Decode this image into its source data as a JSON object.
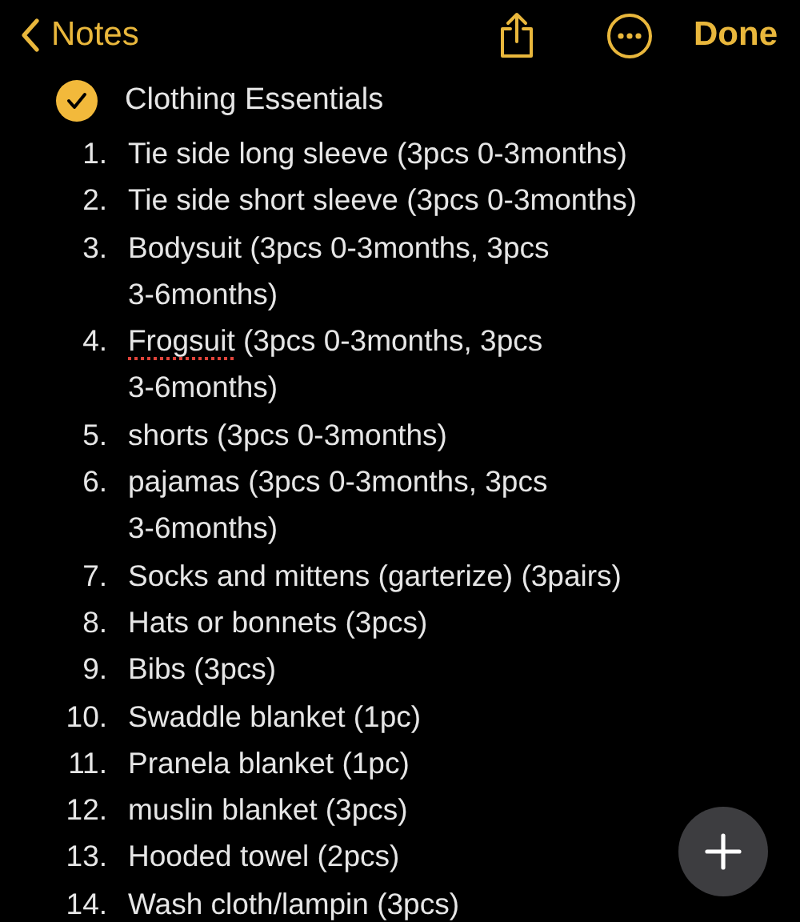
{
  "nav": {
    "back_label": "Notes",
    "done_label": "Done"
  },
  "checklist_title": {
    "text": "Clothing Essentials",
    "checked": true
  },
  "items": [
    {
      "number": "1.",
      "lines": [
        "Tie side long sleeve (3pcs 0-3months)"
      ]
    },
    {
      "number": "2.",
      "lines": [
        "Tie side short sleeve (3pcs 0-3months)"
      ]
    },
    {
      "number": "3.",
      "lines": [
        "Bodysuit (3pcs 0-3months, 3pcs",
        "3-6months)"
      ]
    },
    {
      "number": "4.",
      "flagged_word": "Frogsuit",
      "lines": [
        " (3pcs 0-3months, 3pcs",
        "3-6months)"
      ]
    },
    {
      "number": "5.",
      "lines": [
        "shorts (3pcs 0-3months)"
      ]
    },
    {
      "number": "6.",
      "lines": [
        "pajamas (3pcs 0-3months, 3pcs",
        "3-6months)"
      ]
    },
    {
      "number": "7.",
      "lines": [
        "Socks and mittens (garterize) (3pairs)"
      ]
    },
    {
      "number": "8.",
      "lines": [
        "Hats or bonnets (3pcs)"
      ]
    },
    {
      "number": "9.",
      "lines": [
        "Bibs (3pcs)"
      ]
    },
    {
      "number": "10.",
      "lines": [
        "Swaddle blanket (1pc)"
      ]
    },
    {
      "number": "11.",
      "lines": [
        "Pranela blanket (1pc)"
      ]
    },
    {
      "number": "12.",
      "lines": [
        "muslin blanket (3pcs)"
      ]
    },
    {
      "number": "13.",
      "lines": [
        "Hooded towel (2pcs)"
      ]
    },
    {
      "number": "14.",
      "lines": [
        "Wash cloth/lampin (3pcs)"
      ]
    }
  ]
}
